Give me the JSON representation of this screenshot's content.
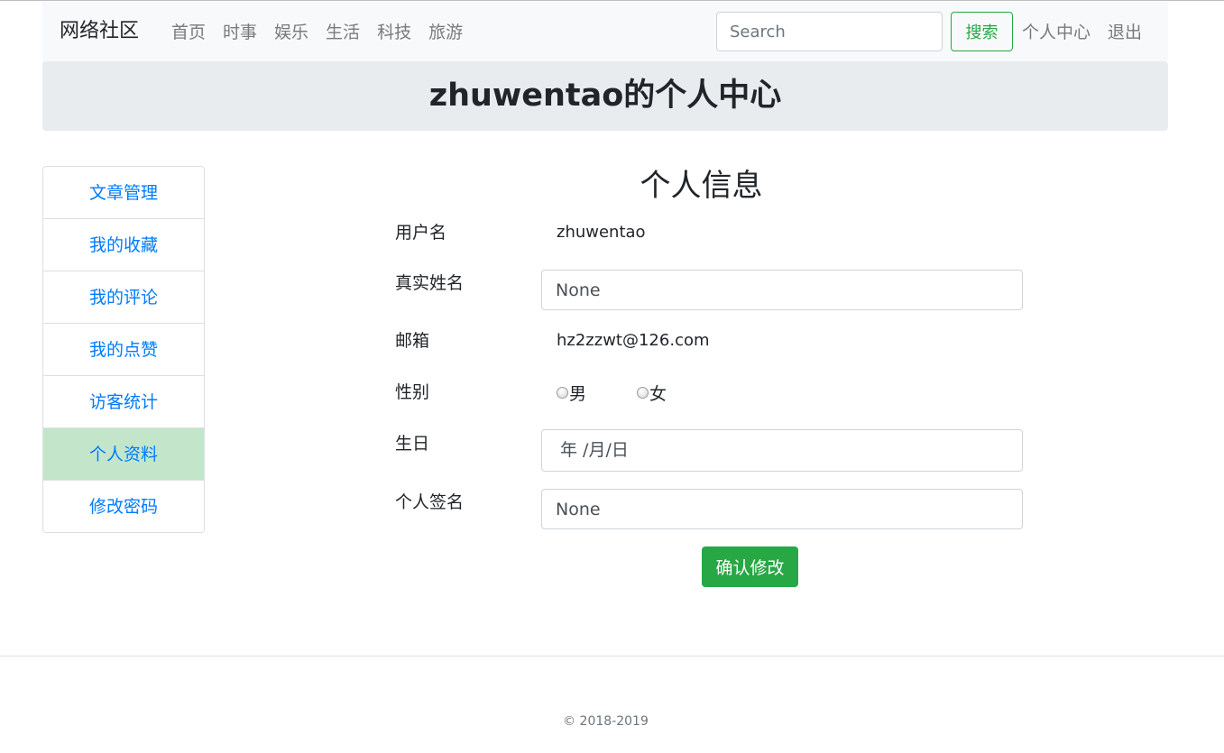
{
  "navbar": {
    "brand": "网络社区",
    "links": [
      "首页",
      "时事",
      "娱乐",
      "生活",
      "科技",
      "旅游"
    ],
    "search_placeholder": "Search",
    "search_button": "搜索",
    "user_center": "个人中心",
    "logout": "退出"
  },
  "jumbotron": {
    "title": "zhuwentao的个人中心"
  },
  "sidebar": {
    "items": [
      "文章管理",
      "我的收藏",
      "我的评论",
      "我的点赞",
      "访客统计",
      "个人资料",
      "修改密码"
    ],
    "active": "个人资料"
  },
  "form": {
    "title": "个人信息",
    "username_label": "用户名",
    "username_value": "zhuwentao",
    "realname_label": "真实姓名",
    "realname_value": "None",
    "email_label": "邮箱",
    "email_value": "hz2zzwt@126.com",
    "gender_label": "性别",
    "gender_options": [
      "男",
      "女"
    ],
    "birthday_label": "生日",
    "birthday_placeholder": "年 /月/日",
    "signature_label": "个人签名",
    "signature_value": "None",
    "submit_label": "确认修改"
  },
  "footer": {
    "copyright": "© 2018-2019"
  },
  "colors": {
    "accent_green": "#28a745",
    "link_blue": "#007bff",
    "active_bg": "#c3e6cb",
    "navbar_bg": "#f8f9fa",
    "jumbotron_bg": "#e9ecef"
  }
}
